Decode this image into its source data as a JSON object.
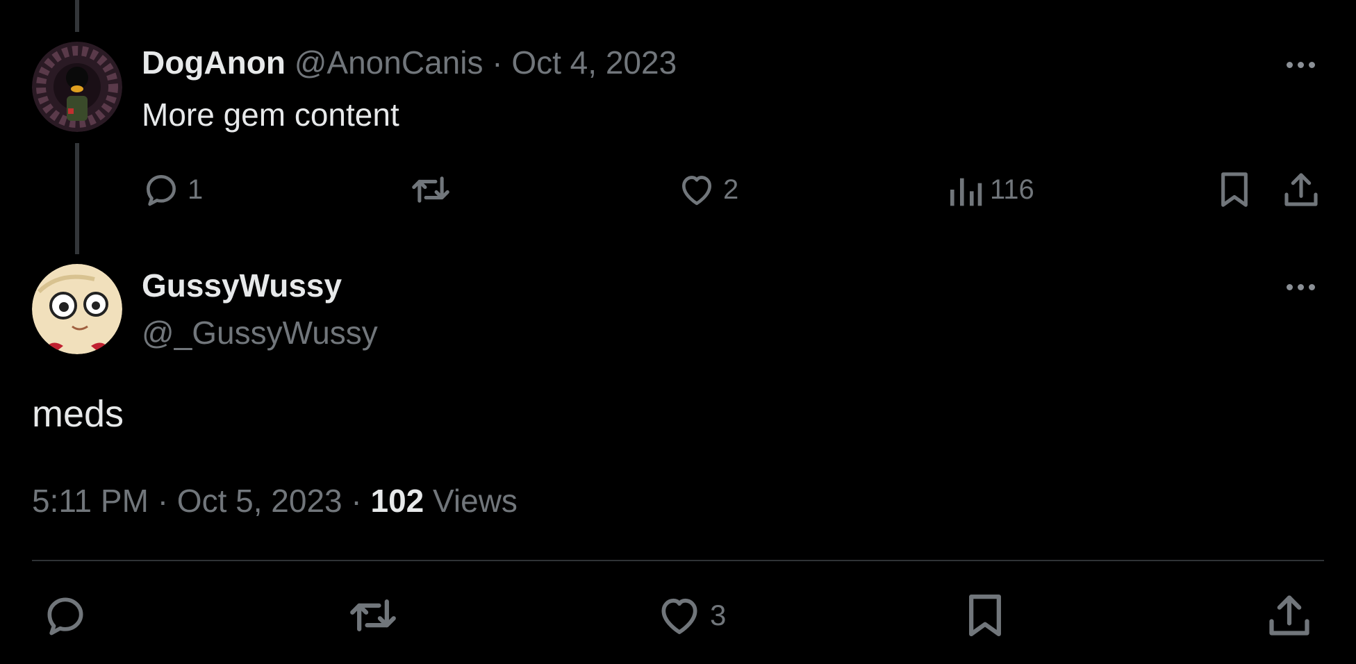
{
  "parent_tweet": {
    "display_name": "DogAnon",
    "handle": "@AnonCanis",
    "separator": "·",
    "date": "Oct 4, 2023",
    "text": "More gem content",
    "replies": "1",
    "likes": "2",
    "views": "116"
  },
  "main_tweet": {
    "display_name": "GussyWussy",
    "handle": "@_GussyWussy",
    "text": "meds",
    "time": "5:11 PM",
    "separator": "·",
    "date": "Oct 5, 2023",
    "views_count": "102",
    "views_label": "Views",
    "likes": "3"
  },
  "icons": {
    "reply": "reply-bubble-icon",
    "retweet": "retweet-icon",
    "like": "heart-icon",
    "views": "analytics-bars-icon",
    "bookmark": "bookmark-icon",
    "share": "share-upload-icon",
    "more": "more-horizontal-icon"
  },
  "colors": {
    "background": "#000000",
    "primary_text": "#e7e9ea",
    "secondary_text": "#71767b",
    "thread_line": "#333639",
    "divider": "#2f3336"
  }
}
